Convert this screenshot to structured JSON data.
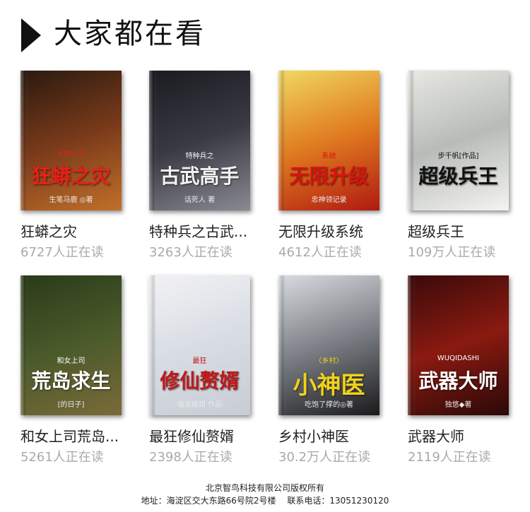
{
  "section": {
    "title": "大家都在看"
  },
  "books": [
    {
      "name": "狂蟒之灾",
      "readers": "6727人正在读",
      "cover_title": "狂蟒之灾",
      "cover_sub": "K·M·Z·Z",
      "cover_author": "生笔马鹿 ◎著",
      "colors": [
        "#2a1a10",
        "#7a3a1a",
        "#c0702a"
      ],
      "title_color": "#e8201a"
    },
    {
      "name": "特种兵之古武...",
      "readers": "3263人正在读",
      "cover_title": "古武高手",
      "cover_sub": "特种兵之",
      "cover_author": "话死人 著",
      "colors": [
        "#1a1a20",
        "#3a3a44",
        "#8a8a95"
      ],
      "title_color": "#f2f2f2"
    },
    {
      "name": "无限升级系统",
      "readers": "4612人正在读",
      "cover_title": "无限升级",
      "cover_sub": "系统",
      "cover_author": "忠神领记录",
      "colors": [
        "#f0d860",
        "#e07a20",
        "#b01a10"
      ],
      "title_color": "#d8140e"
    },
    {
      "name": "超级兵王",
      "readers": "109万人正在读",
      "cover_title": "超级兵王",
      "cover_sub": "步千帆[作品]",
      "cover_author": "",
      "colors": [
        "#e8e8e4",
        "#b8bcb8",
        "#f4f4f0"
      ],
      "title_color": "#111111"
    },
    {
      "name": "和女上司荒岛...",
      "readers": "5261人正在读",
      "cover_title": "荒岛求生",
      "cover_sub": "和女上司",
      "cover_author": "[的日子]",
      "colors": [
        "#2a3a1a",
        "#4a5a2a",
        "#7a6a3a"
      ],
      "title_color": "#ffffff"
    },
    {
      "name": "最狂修仙赘婿",
      "readers": "2398人正在读",
      "cover_title": "修仙赘婿",
      "cover_sub": "最狂",
      "cover_author": "-榴莲糖甜 作品-",
      "colors": [
        "#f2f2f4",
        "#d8dde4",
        "#c8ccd4"
      ],
      "title_color": "#c01818"
    },
    {
      "name": "乡村小神医",
      "readers": "30.2万人正在读",
      "cover_title": "小神医",
      "cover_sub": "〈乡村〉",
      "cover_author": "吃饱了撑的◎著",
      "colors": [
        "#d8dce0",
        "#7a7e84",
        "#1a1a1c"
      ],
      "title_color": "#f0d21a"
    },
    {
      "name": "武器大师",
      "readers": "2119人正在读",
      "cover_title": "武器大师",
      "cover_sub": "WUQIDASHI",
      "cover_author": "独悠◆著",
      "colors": [
        "#3a0a0a",
        "#8a1a10",
        "#2a0808"
      ],
      "title_color": "#ffffff"
    }
  ],
  "footer": {
    "company": "北京智鸟科技有限公司版权所有",
    "address": "地址：海淀区交大东路66号院2号楼",
    "phone": "联系电话：13051230120"
  }
}
